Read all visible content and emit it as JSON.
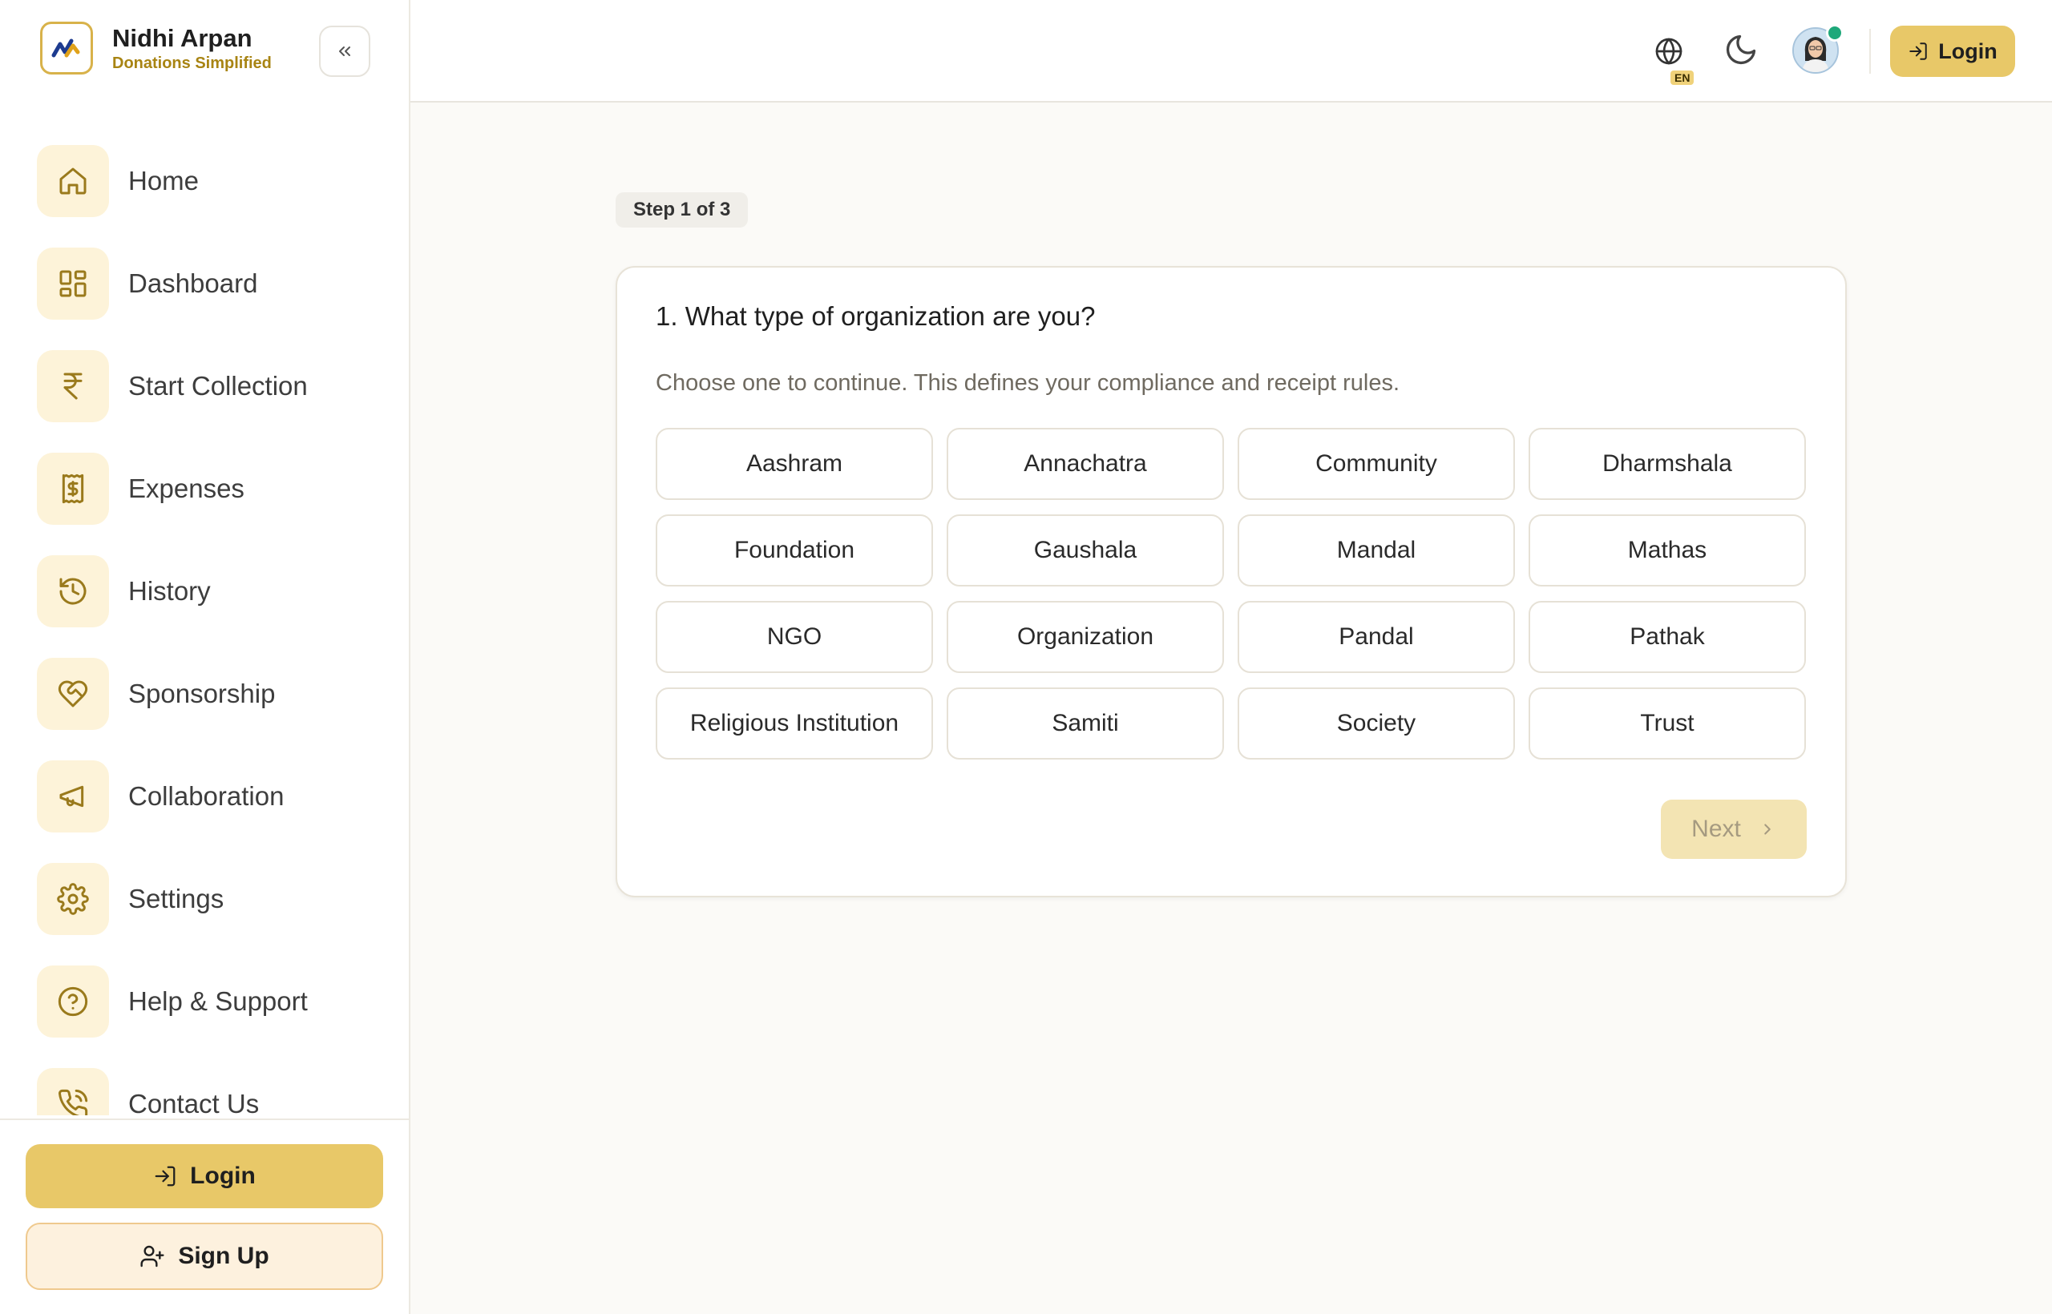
{
  "brand": {
    "name": "Nidhi Arpan",
    "tagline": "Donations Simplified"
  },
  "sidebar": {
    "collapse_icon": "chevrons-left-icon",
    "items": [
      {
        "label": "Home",
        "icon": "home-icon"
      },
      {
        "label": "Dashboard",
        "icon": "grid-icon"
      },
      {
        "label": "Start Collection",
        "icon": "rupee-icon"
      },
      {
        "label": "Expenses",
        "icon": "receipt-icon"
      },
      {
        "label": "History",
        "icon": "history-icon"
      },
      {
        "label": "Sponsorship",
        "icon": "heart-handshake-icon"
      },
      {
        "label": "Collaboration",
        "icon": "megaphone-icon"
      },
      {
        "label": "Settings",
        "icon": "gear-icon"
      },
      {
        "label": "Help & Support",
        "icon": "help-circle-icon"
      },
      {
        "label": "Contact Us",
        "icon": "phone-icon"
      }
    ],
    "login_label": "Login",
    "signup_label": "Sign Up"
  },
  "topbar": {
    "language_badge": "EN",
    "login_label": "Login"
  },
  "wizard": {
    "step_label": "Step 1 of 3",
    "question": "1. What type of organization are you?",
    "subtitle": "Choose one to continue. This defines your compliance and receipt rules.",
    "options": [
      "Aashram",
      "Annachatra",
      "Community",
      "Dharmshala",
      "Foundation",
      "Gaushala",
      "Mandal",
      "Mathas",
      "NGO",
      "Organization",
      "Pandal",
      "Pathak",
      "Religious Institution",
      "Samiti",
      "Society",
      "Trust"
    ],
    "next_label": "Next"
  },
  "colors": {
    "accent": "#e8c868",
    "accent_soft": "#fdf3d9",
    "brand_text": "#a88413",
    "icon_stroke": "#9a7a1c"
  }
}
